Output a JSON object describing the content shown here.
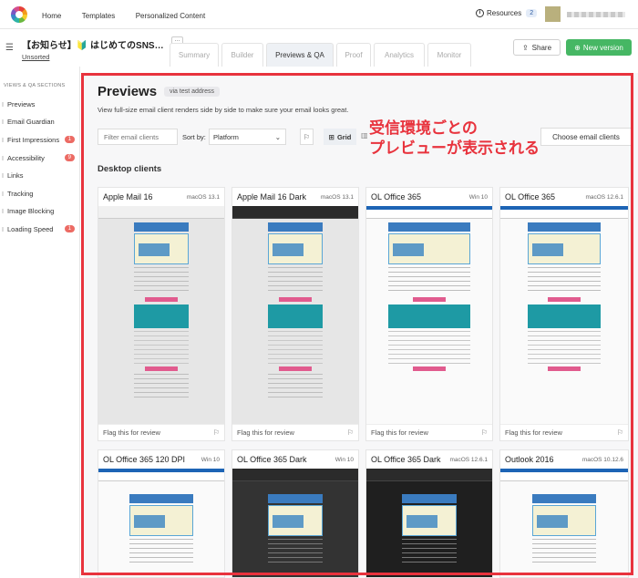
{
  "topnav": {
    "items": [
      "Home",
      "Templates",
      "Personalized Content"
    ],
    "resources_label": "Resources",
    "resources_count": "2"
  },
  "campaign": {
    "title": "【お知らせ】🔰 はじめてのSNS…",
    "folder": "Unsorted",
    "ellipsis": "…"
  },
  "tabs": [
    {
      "label": "Summary",
      "active": false
    },
    {
      "label": "Builder",
      "active": false
    },
    {
      "label": "Previews & QA",
      "active": true
    },
    {
      "label": "Proof",
      "active": false
    },
    {
      "label": "Analytics",
      "active": false
    },
    {
      "label": "Monitor",
      "active": false
    }
  ],
  "actions": {
    "share": "Share",
    "new_version": "New version"
  },
  "sidebar": {
    "heading": "VIEWS & QA SECTIONS",
    "items": [
      {
        "label": "Previews",
        "badge": ""
      },
      {
        "label": "Email Guardian",
        "badge": ""
      },
      {
        "label": "First Impressions",
        "badge": "1"
      },
      {
        "label": "Accessibility",
        "badge": "9"
      },
      {
        "label": "Links",
        "badge": ""
      },
      {
        "label": "Tracking",
        "badge": ""
      },
      {
        "label": "Image Blocking",
        "badge": ""
      },
      {
        "label": "Loading Speed",
        "badge": "1"
      }
    ]
  },
  "main": {
    "title": "Previews",
    "via": "via test address",
    "description": "View full-size email client renders side by side to make sure your email looks great.",
    "filter_placeholder": "Filter email clients",
    "sort_label": "Sort by:",
    "sort_value": "Platform",
    "grid_label": "Grid",
    "choose_label": "Choose email clients",
    "annotation_line1": "受信環境ごとの",
    "annotation_line2": "プレビューが表示される",
    "section_heading": "Desktop clients",
    "flag_label": "Flag this for review"
  },
  "clients": [
    {
      "name": "Apple Mail 16",
      "os": "macOS 13.1",
      "theme": "light"
    },
    {
      "name": "Apple Mail 16 Dark",
      "os": "macOS 13.1",
      "theme": "dark"
    },
    {
      "name": "OL Office 365",
      "os": "Win 10",
      "theme": "win"
    },
    {
      "name": "OL Office 365",
      "os": "macOS 12.6.1",
      "theme": "win"
    },
    {
      "name": "OL Office 365 120 DPI",
      "os": "Win 10",
      "theme": "win"
    },
    {
      "name": "OL Office 365 Dark",
      "os": "Win 10",
      "theme": "dark"
    },
    {
      "name": "OL Office 365 Dark",
      "os": "macOS 12.6.1",
      "theme": "dark"
    },
    {
      "name": "Outlook 2016",
      "os": "macOS 10.12.6",
      "theme": "win"
    }
  ],
  "colors": {
    "accent_green": "#46b764",
    "annotation_red": "#e8333d",
    "badge_red": "#ec6b64"
  }
}
